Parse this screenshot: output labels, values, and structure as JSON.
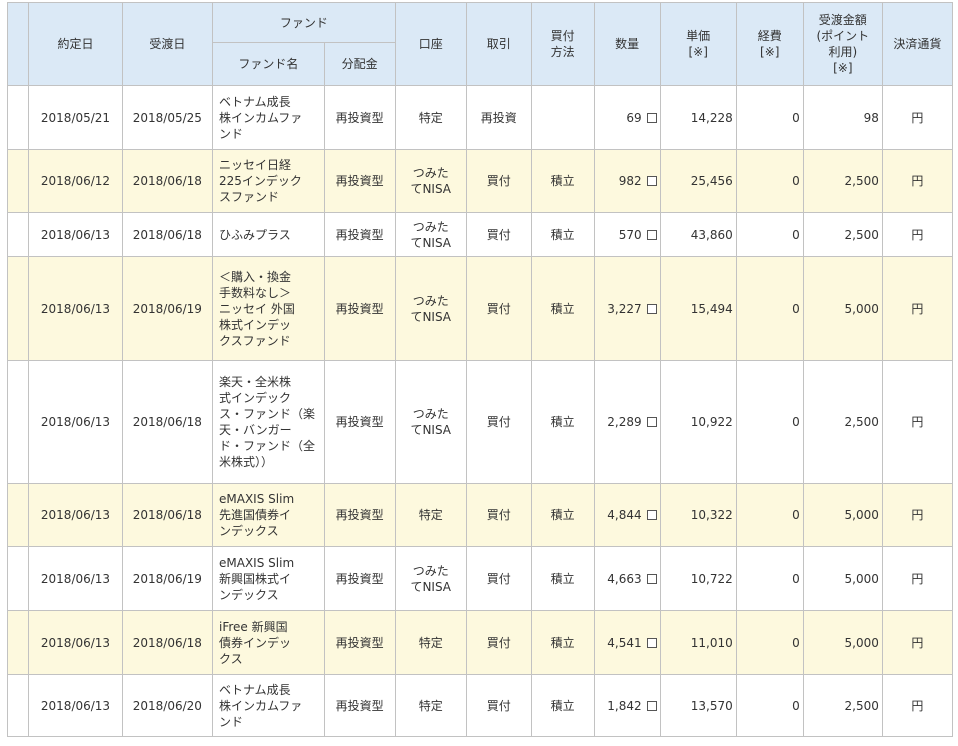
{
  "headers": {
    "trade_date": "約定日",
    "settle_date": "受渡日",
    "fund_group": "ファンド",
    "fund_name": "ファンド名",
    "dividend": "分配金",
    "account": "口座",
    "transaction": "取引",
    "buy_method": "買付\n方法",
    "quantity": "数量",
    "unit_price": "単価\n[※]",
    "fee": "経費\n[※]",
    "amount": "受渡金額\n(ポイント\n利用)\n[※]",
    "currency": "決済通貨"
  },
  "rows": [
    {
      "trade_date": "2018/05/21",
      "settle_date": "2018/05/25",
      "fund_name": "ベトナム成長\n株インカムファ\nンド",
      "dividend": "再投資型",
      "account": "特定",
      "transaction": "再投資",
      "buy_method": "",
      "quantity": "69",
      "unit_price": "14,228",
      "fee": "0",
      "amount": "98",
      "currency": "円"
    },
    {
      "trade_date": "2018/06/12",
      "settle_date": "2018/06/18",
      "fund_name": "ニッセイ日経\n225インデック\nスファンド",
      "dividend": "再投資型",
      "account": "つみた\nてNISA",
      "transaction": "買付",
      "buy_method": "積立",
      "quantity": "982",
      "unit_price": "25,456",
      "fee": "0",
      "amount": "2,500",
      "currency": "円"
    },
    {
      "trade_date": "2018/06/13",
      "settle_date": "2018/06/18",
      "fund_name": "ひふみプラス",
      "dividend": "再投資型",
      "account": "つみた\nてNISA",
      "transaction": "買付",
      "buy_method": "積立",
      "quantity": "570",
      "unit_price": "43,860",
      "fee": "0",
      "amount": "2,500",
      "currency": "円"
    },
    {
      "trade_date": "2018/06/13",
      "settle_date": "2018/06/19",
      "fund_name": "＜購入・換金\n手数料なし＞\nニッセイ 外国\n株式インデッ\nクスファンド",
      "dividend": "再投資型",
      "account": "つみた\nてNISA",
      "transaction": "買付",
      "buy_method": "積立",
      "quantity": "3,227",
      "unit_price": "15,494",
      "fee": "0",
      "amount": "5,000",
      "currency": "円"
    },
    {
      "trade_date": "2018/06/13",
      "settle_date": "2018/06/18",
      "fund_name": "楽天・全米株\n式インデック\nス・ファンド（楽\n天・バンガー\nド・ファンド（全\n米株式））",
      "dividend": "再投資型",
      "account": "つみた\nてNISA",
      "transaction": "買付",
      "buy_method": "積立",
      "quantity": "2,289",
      "unit_price": "10,922",
      "fee": "0",
      "amount": "2,500",
      "currency": "円"
    },
    {
      "trade_date": "2018/06/13",
      "settle_date": "2018/06/18",
      "fund_name": "eMAXIS Slim\n先進国債券イ\nンデックス",
      "dividend": "再投資型",
      "account": "特定",
      "transaction": "買付",
      "buy_method": "積立",
      "quantity": "4,844",
      "unit_price": "10,322",
      "fee": "0",
      "amount": "5,000",
      "currency": "円"
    },
    {
      "trade_date": "2018/06/13",
      "settle_date": "2018/06/19",
      "fund_name": "eMAXIS Slim\n新興国株式イ\nンデックス",
      "dividend": "再投資型",
      "account": "つみた\nてNISA",
      "transaction": "買付",
      "buy_method": "積立",
      "quantity": "4,663",
      "unit_price": "10,722",
      "fee": "0",
      "amount": "5,000",
      "currency": "円"
    },
    {
      "trade_date": "2018/06/13",
      "settle_date": "2018/06/18",
      "fund_name": "iFree 新興国\n債券インデッ\nクス",
      "dividend": "再投資型",
      "account": "特定",
      "transaction": "買付",
      "buy_method": "積立",
      "quantity": "4,541",
      "unit_price": "11,010",
      "fee": "0",
      "amount": "5,000",
      "currency": "円"
    },
    {
      "trade_date": "2018/06/13",
      "settle_date": "2018/06/20",
      "fund_name": "ベトナム成長\n株インカムファ\nンド",
      "dividend": "再投資型",
      "account": "特定",
      "transaction": "買付",
      "buy_method": "積立",
      "quantity": "1,842",
      "unit_price": "13,570",
      "fee": "0",
      "amount": "2,500",
      "currency": "円"
    }
  ],
  "icons": {
    "quantity_marker": "checkbox-icon"
  }
}
